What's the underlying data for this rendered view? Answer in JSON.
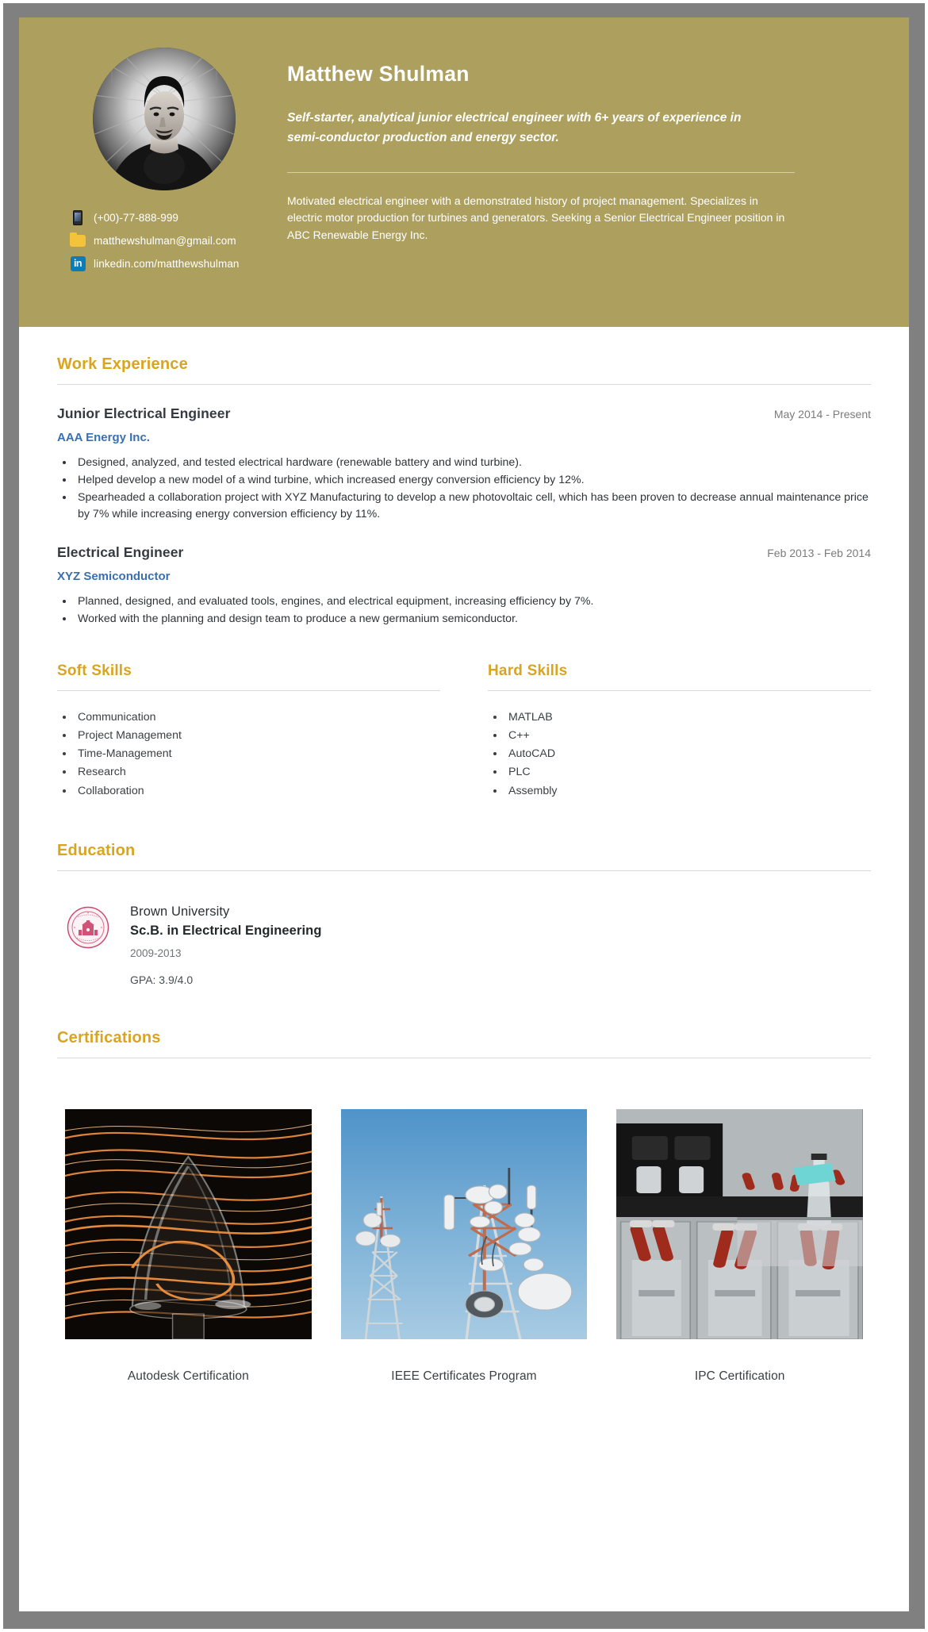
{
  "header": {
    "name": "Matthew Shulman",
    "tagline": "Self-starter, analytical junior electrical engineer with 6+ years of experience in semi-conductor production and energy sector.",
    "summary": "Motivated electrical engineer with a demonstrated history of project management. Specializes in electric motor production for turbines and generators. Seeking a Senior Electrical Engineer position in ABC Renewable Energy Inc.",
    "accent_color": "#ada05f",
    "contacts": [
      {
        "icon": "phone-icon",
        "text": "(+00)-77-888-999"
      },
      {
        "icon": "folder-icon",
        "text": "matthewshulman@gmail.com"
      },
      {
        "icon": "linkedin-icon",
        "text": "linkedin.com/matthewshulman",
        "glyph": "in"
      }
    ]
  },
  "work": {
    "title": "Work Experience",
    "jobs": [
      {
        "title": "Junior Electrical Engineer",
        "dates": "May 2014 - Present",
        "company": "AAA Energy Inc.",
        "bullets": [
          "Designed, analyzed, and tested electrical hardware (renewable battery and wind turbine).",
          "Helped develop a new model of a wind turbine, which increased energy conversion efficiency by 12%.",
          "Spearheaded a collaboration project with XYZ Manufacturing to develop a new photovoltaic cell, which has been proven to decrease annual maintenance price by 7% while increasing energy conversion efficiency by 11%."
        ]
      },
      {
        "title": "Electrical Engineer",
        "dates": "Feb 2013 - Feb 2014",
        "company": "XYZ Semiconductor",
        "bullets": [
          "Planned, designed, and evaluated tools, engines, and electrical equipment, increasing efficiency by 7%.",
          "Worked with the planning and design team to produce a new germanium semiconductor."
        ]
      }
    ]
  },
  "soft_skills": {
    "title": "Soft Skills",
    "items": [
      "Communication",
      "Project Management",
      "Time-Management",
      "Research",
      "Collaboration"
    ]
  },
  "hard_skills": {
    "title": "Hard Skills",
    "items": [
      "MATLAB",
      "C++",
      "AutoCAD",
      "PLC",
      "Assembly"
    ]
  },
  "education": {
    "title": "Education",
    "entries": [
      {
        "school": "Brown University",
        "degree": "Sc.B. in Electrical Engineering",
        "years": "2009-2013",
        "gpa": "GPA: 3.9/4.0",
        "seal": "brown-university-seal"
      }
    ]
  },
  "certifications": {
    "title": "Certifications",
    "items": [
      {
        "caption": "Autodesk Certification",
        "image": "light-streaks-bulb-photo"
      },
      {
        "caption": "IEEE Certificates Program",
        "image": "telecom-towers-photo"
      },
      {
        "caption": "IPC Certification",
        "image": "electrical-switchgear-photo"
      }
    ]
  },
  "colors": {
    "gold_header": "#ada05f",
    "section_heading": "#d9a520",
    "company_link": "#3a6fb0",
    "frame": "#808080"
  }
}
